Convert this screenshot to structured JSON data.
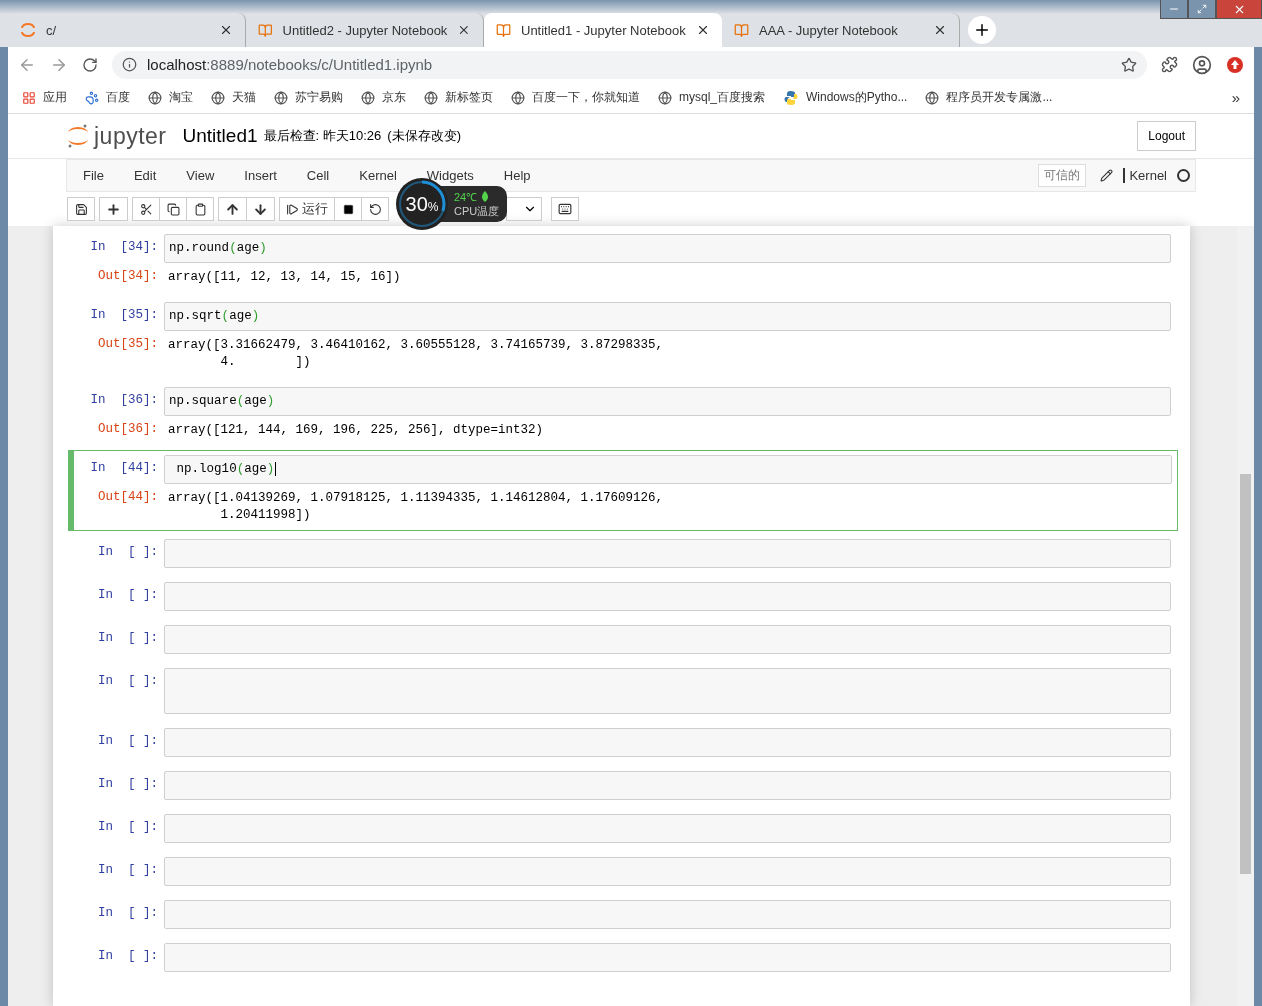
{
  "browser": {
    "tabs": [
      {
        "label": "c/",
        "kind": "jupyter",
        "selected": false
      },
      {
        "label": "Untitled2 - Jupyter Notebook",
        "kind": "book",
        "selected": false
      },
      {
        "label": "Untitled1 - Jupyter Notebook",
        "kind": "book",
        "selected": true
      },
      {
        "label": "AAA - Jupyter Notebook",
        "kind": "book",
        "selected": false
      }
    ],
    "address": {
      "host": "localhost",
      "rest": ":8889/notebooks/c/Untitled1.ipynb"
    },
    "bookmarks": [
      {
        "label": "应用",
        "kind": "apps"
      },
      {
        "label": "百度",
        "kind": "paw"
      },
      {
        "label": "淘宝",
        "kind": "globe"
      },
      {
        "label": "天猫",
        "kind": "globe"
      },
      {
        "label": "苏宁易购",
        "kind": "globe"
      },
      {
        "label": "京东",
        "kind": "globe"
      },
      {
        "label": "新标签页",
        "kind": "globe"
      },
      {
        "label": "百度一下，你就知道",
        "kind": "globe"
      },
      {
        "label": "mysql_百度搜索",
        "kind": "globe"
      },
      {
        "label": "Windows的Pytho...",
        "kind": "python"
      },
      {
        "label": "程序员开发专属激...",
        "kind": "globe"
      }
    ],
    "more": "»"
  },
  "header": {
    "logo": "jupyter",
    "notebook_name": "Untitled1",
    "checkpoint": "最后检查: 昨天10:26",
    "unsaved": "(未保存改变)",
    "logout": "Logout"
  },
  "menu": {
    "items": [
      "File",
      "Edit",
      "View",
      "Insert",
      "Cell",
      "Kernel",
      "Widgets",
      "Help"
    ],
    "trusted": "可信的",
    "kernel": "Kernel",
    "kernel_busy": false
  },
  "toolbar": {
    "run": "运行"
  },
  "cpu_widget": {
    "percent": "30",
    "unit": "%",
    "temp": "24℃",
    "label": "CPU温度",
    "level": 0.3
  },
  "cells": [
    {
      "kind": "code",
      "prompt": "In  [34]:",
      "code": "np.round(age)",
      "out_prompt": "Out[34]:",
      "output": [
        "array([11, 12, 13, 14, 15, 16])"
      ],
      "selected": false
    },
    {
      "kind": "code",
      "prompt": "In  [35]:",
      "code": "np.sqrt(age)",
      "out_prompt": "Out[35]:",
      "output": [
        "array([3.31662479, 3.46410162, 3.60555128, 3.74165739, 3.87298335,",
        "       4.        ])"
      ],
      "selected": false
    },
    {
      "kind": "code",
      "prompt": "In  [36]:",
      "code": "np.square(age)",
      "out_prompt": "Out[36]:",
      "output": [
        "array([121, 144, 169, 196, 225, 256], dtype=int32)"
      ],
      "selected": false
    },
    {
      "kind": "code",
      "prompt": "In  [44]:",
      "code": " np.log10(age)",
      "out_prompt": "Out[44]:",
      "output": [
        "array([1.04139269, 1.07918125, 1.11394335, 1.14612804, 1.17609126,",
        "       1.20411998])"
      ],
      "selected": true
    },
    {
      "kind": "empty",
      "prompt": "In  [ ]:",
      "multiline": false
    },
    {
      "kind": "empty",
      "prompt": "In  [ ]:",
      "multiline": false
    },
    {
      "kind": "empty",
      "prompt": "In  [ ]:",
      "multiline": false
    },
    {
      "kind": "empty",
      "prompt": "In  [ ]:",
      "multiline": true
    },
    {
      "kind": "empty",
      "prompt": "In  [ ]:",
      "multiline": false
    },
    {
      "kind": "empty",
      "prompt": "In  [ ]:",
      "multiline": false
    },
    {
      "kind": "empty",
      "prompt": "In  [ ]:",
      "multiline": false
    },
    {
      "kind": "empty",
      "prompt": "In  [ ]:",
      "multiline": false
    },
    {
      "kind": "empty",
      "prompt": "In  [ ]:",
      "multiline": false
    },
    {
      "kind": "empty",
      "prompt": "In  [ ]:",
      "multiline": false
    }
  ]
}
